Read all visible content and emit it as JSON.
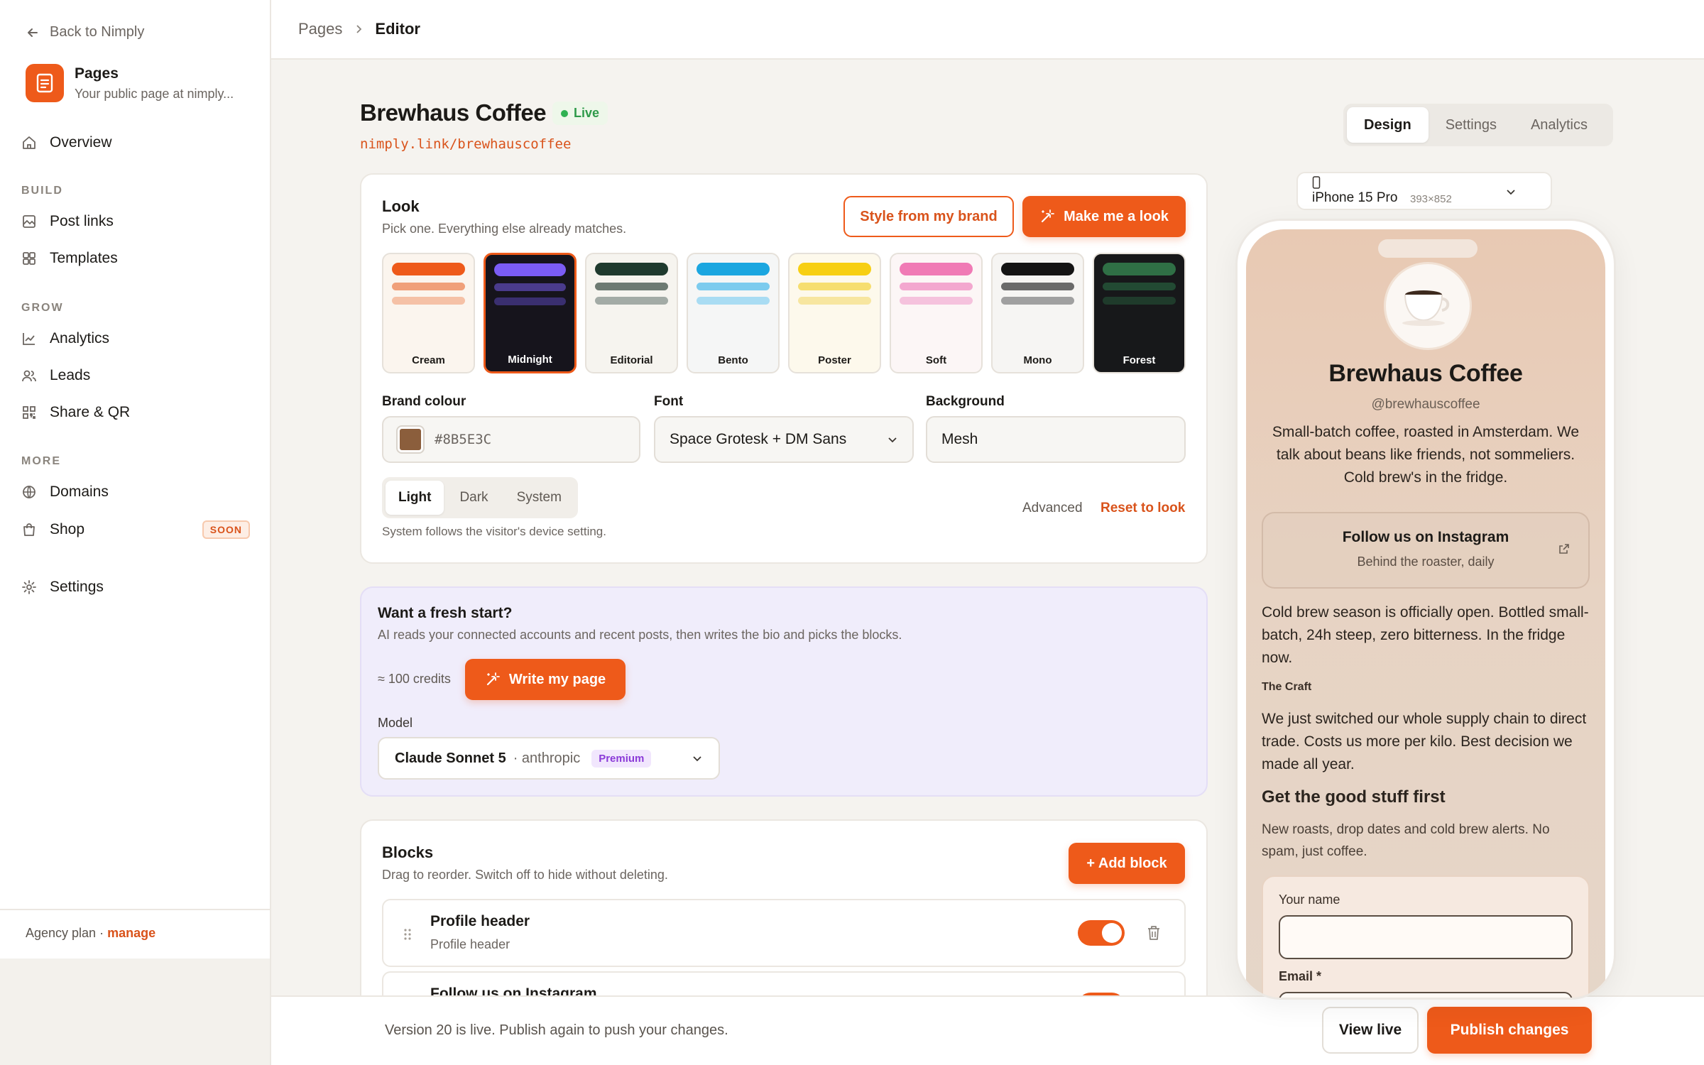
{
  "sidebar": {
    "back_label": "Back to Nimply",
    "app_name": "Pages",
    "app_sub": "Your public page at nimply...",
    "overview": "Overview",
    "sections": {
      "build": "BUILD",
      "grow": "GROW",
      "more": "MORE"
    },
    "items": {
      "post_links": "Post links",
      "templates": "Templates",
      "analytics": "Analytics",
      "leads": "Leads",
      "share_qr": "Share & QR",
      "domains": "Domains",
      "shop": "Shop",
      "settings": "Settings"
    },
    "soon_badge": "SOON",
    "footer_plan": "Agency plan · ",
    "footer_manage": "manage"
  },
  "breadcrumb": {
    "parent": "Pages",
    "current": "Editor"
  },
  "header": {
    "title": "Brewhaus Coffee",
    "status": "Live",
    "url": "nimply.link/brewhauscoffee"
  },
  "tabs": [
    "Design",
    "Settings",
    "Analytics"
  ],
  "look": {
    "title": "Look",
    "subtitle": "Pick one. Everything else already matches.",
    "style_from_brand": "Style from my brand",
    "make_me_a_look": "Make me a look",
    "themes": [
      {
        "name": "Cream",
        "bg": "#fbf5ee",
        "c1": "#ee5a1a",
        "c2": "#f0a07a",
        "c3": "#f5c1a6",
        "text": "#1c1a17"
      },
      {
        "name": "Midnight",
        "bg": "#16141c",
        "c1": "#7b5cf5",
        "c2": "#4a3b8c",
        "c3": "#3a2f70",
        "text": "#ffffff"
      },
      {
        "name": "Editorial",
        "bg": "#f6f4ef",
        "c1": "#1f3a2e",
        "c2": "#6d7a72",
        "c3": "#a3aba6",
        "text": "#1c1a17"
      },
      {
        "name": "Bento",
        "bg": "#f5f6f6",
        "c1": "#1ba6e0",
        "c2": "#7ccbee",
        "c3": "#a9dcf3",
        "text": "#1c1a17"
      },
      {
        "name": "Poster",
        "bg": "#fdf9ec",
        "c1": "#f7cf12",
        "c2": "#f6de70",
        "c3": "#f7e6a0",
        "text": "#1c1a17"
      },
      {
        "name": "Soft",
        "bg": "#fcf6f6",
        "c1": "#f07ab5",
        "c2": "#f3a7cf",
        "c3": "#f5c2dd",
        "text": "#1c1a17"
      },
      {
        "name": "Mono",
        "bg": "#f6f5f3",
        "c1": "#141414",
        "c2": "#6a6a6a",
        "c3": "#a0a0a0",
        "text": "#1c1a17"
      },
      {
        "name": "Forest",
        "bg": "#17181a",
        "c1": "#2f6f45",
        "c2": "#224a33",
        "c3": "#1f3b2b",
        "text": "#ffffff"
      }
    ],
    "selected_theme": "Midnight",
    "brand_colour_label": "Brand colour",
    "brand_colour_value": "#8B5E3C",
    "font_label": "Font",
    "font_value": "Space Grotesk + DM Sans",
    "background_label": "Background",
    "background_value": "Mesh",
    "modes": [
      "Light",
      "Dark",
      "System"
    ],
    "mode_selected": "Light",
    "advanced": "Advanced",
    "reset": "Reset to look",
    "mode_hint": "System follows the visitor's device setting."
  },
  "fresh": {
    "title": "Want a fresh start?",
    "subtitle": "AI reads your connected accounts and recent posts, then writes the bio and picks the blocks.",
    "credits": "≈ 100 credits",
    "write_button": "Write my page",
    "model_label": "Model",
    "model_name": "Claude Sonnet 5",
    "model_provider": "· anthropic",
    "model_tier": "Premium"
  },
  "blocks": {
    "title": "Blocks",
    "subtitle": "Drag to reorder. Switch off to hide without deleting.",
    "add_button": "+ Add block",
    "rows": [
      {
        "title": "Profile header",
        "sub": "Profile header"
      },
      {
        "title": "Follow us on Instagram",
        "sub": ""
      }
    ]
  },
  "publish": {
    "message": "Version 20 is live. Publish again to push your changes.",
    "view_live": "View live",
    "publish": "Publish changes"
  },
  "preview": {
    "device": "iPhone 15 Pro",
    "device_size": "393×852",
    "name": "Brewhaus Coffee",
    "handle": "@brewhauscoffee",
    "bio": "Small-batch coffee, roasted in Amsterdam. We talk about beans like friends, not sommeliers. Cold brew's in the fridge.",
    "link_title": "Follow us on Instagram",
    "link_sub": "Behind the roaster, daily",
    "post1": "Cold brew season is officially open. Bottled small-batch, 24h steep, zero bitterness. In the fridge now.",
    "craft_heading": "The Craft",
    "post2": "We just switched our whole supply chain to direct trade. Costs us more per kilo. Best decision we made all year.",
    "signup_heading": "Get the good stuff first",
    "signup_text": "New roasts, drop dates and cold brew alerts. No spam, just coffee.",
    "name_label": "Your name",
    "email_label": "Email *"
  },
  "colors": {
    "accent": "#ee5a1a",
    "live": "#2fb152",
    "premium": "#8b3ad8"
  }
}
